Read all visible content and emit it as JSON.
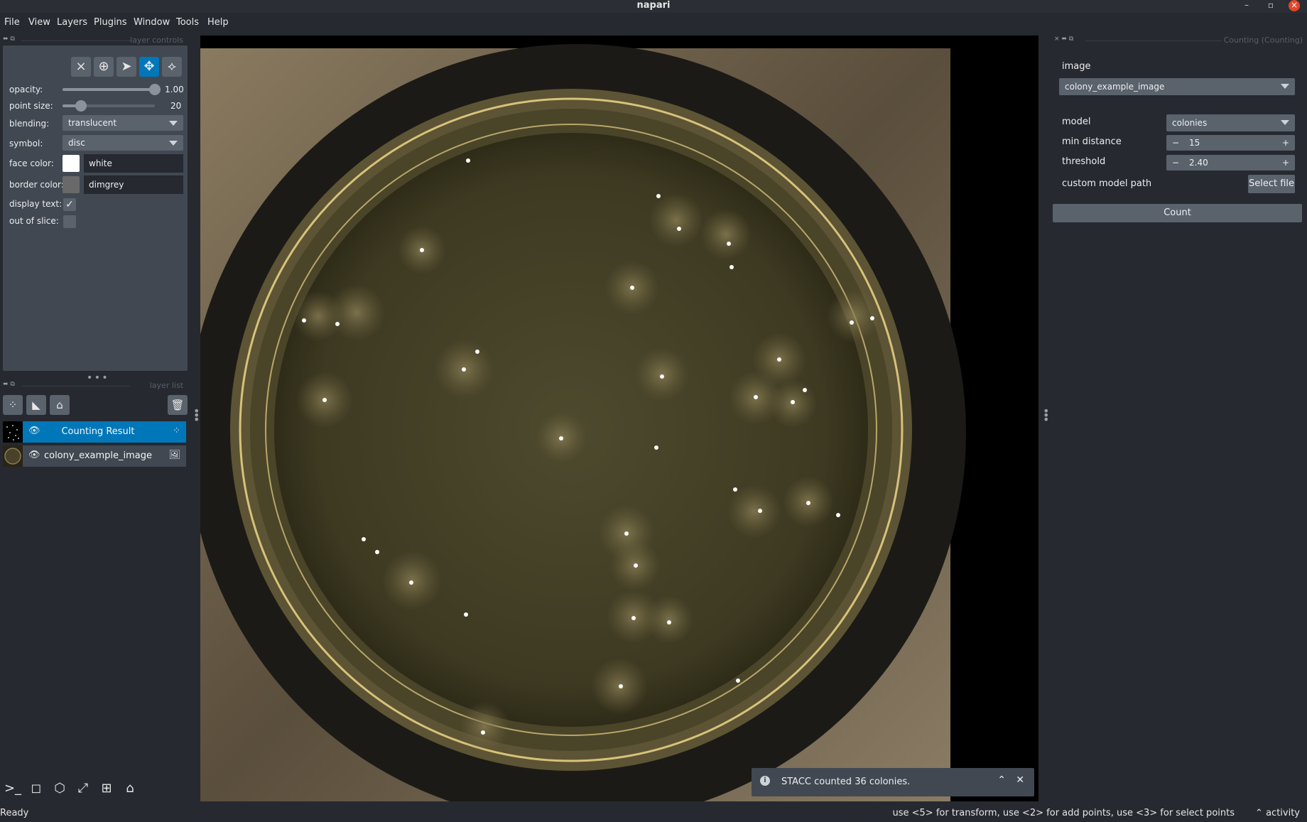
{
  "window": {
    "title": "napari"
  },
  "menu": [
    "File",
    "View",
    "Layers",
    "Plugins",
    "Window",
    "Tools",
    "Help"
  ],
  "layer_controls": {
    "header": "layer controls",
    "opacity": {
      "label": "opacity:",
      "value": "1.00",
      "level": 1.0
    },
    "point_size": {
      "label": "point size:",
      "value": "20",
      "level": 0.2
    },
    "blending": {
      "label": "blending:",
      "value": "translucent"
    },
    "symbol": {
      "label": "symbol:",
      "value": "disc"
    },
    "face_color": {
      "label": "face color:",
      "value": "white",
      "swatch": "#ffffff"
    },
    "border_color": {
      "label": "border color:",
      "value": "dimgrey",
      "swatch": "#696969"
    },
    "display_text": {
      "label": "display text:",
      "checked": true,
      "mark": "✓"
    },
    "out_of_slice": {
      "label": "out of slice:",
      "checked": false
    }
  },
  "layer_list": {
    "header": "layer list",
    "layers": [
      {
        "name": "Counting Result",
        "selected": true,
        "type_icon": "points-icon"
      },
      {
        "name": "colony_example_image",
        "selected": false,
        "type_icon": "image-icon"
      }
    ]
  },
  "counting_panel": {
    "header": "Counting (Counting)",
    "image_label": "image",
    "image_value": "colony_example_image",
    "model_label": "model",
    "model_value": "colonies",
    "min_distance_label": "min distance",
    "min_distance_value": "15",
    "threshold_label": "threshold",
    "threshold_value": "2.40",
    "custom_model_label": "custom model path",
    "custom_model_value": "",
    "select_file_label": "Select file",
    "count_label": "Count",
    "minus": "−",
    "plus": "+"
  },
  "notification": {
    "text": "STACC counted 36 colonies."
  },
  "status": {
    "left": "Ready",
    "help": "use <5> for transform, use <2> for add points, use <3> for select points",
    "activity": "activity"
  },
  "colors": {
    "accent": "#0077b8",
    "bg": "#262930",
    "panel": "#414851",
    "widget": "#5a626c"
  }
}
